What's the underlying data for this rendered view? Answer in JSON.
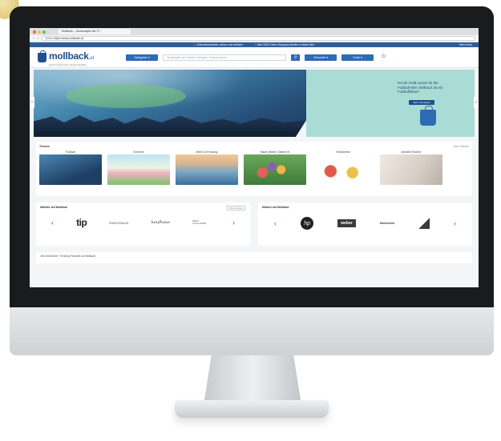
{
  "browser": {
    "tab_title": "Mollback – Gewinnspiel der Fi...",
    "url_secure": "Sicher",
    "url_host": "https://www.mollback.at",
    "nav_back": "‹",
    "nav_forward": "›",
    "dot_colors": [
      "#ec5f59",
      "#f5bf4f",
      "#61c554"
    ]
  },
  "promo": {
    "left": "✓ Gutscheinsvorteile, sichern und einlösen",
    "middle": "✓ Über 5000 Online-Shopping-Händler in dieser Mini",
    "right": "Mein Konto"
  },
  "header": {
    "logo_name": "mollback",
    "logo_tld": ".at",
    "logo_tagline": "Geld zurück beim Online-Einkauf",
    "categories_label": "Kategorien ▾",
    "search_placeholder": "Suchbegriff oder Händler, Kategorie, Produkt suchen",
    "search_icon": "magnifier",
    "select1_label": "Einkaufen ▾",
    "select2_label": "Konto ▾",
    "logout_icon": "power"
  },
  "hero": {
    "text": "Hol dir Geld zurück für die Fußball-WM. Mollback ist ein Fußballfieber!",
    "cta": "Jetzt mitmachen",
    "prev": "‹",
    "next": "›"
  },
  "topics": {
    "heading": "Themen",
    "more": "Alle Themen",
    "items": [
      {
        "label": "Fußball"
      },
      {
        "label": "Sommer"
      },
      {
        "label": "Meer & Erholung"
      },
      {
        "label": "Mach deinen Garten fit"
      },
      {
        "label": "Geschenke"
      },
      {
        "label": "Aktuelle Bücher"
      }
    ]
  },
  "brands_left": {
    "heading": "Händler auf Mollback",
    "filter": "Alle anzeigen",
    "prev": "‹",
    "next": "›",
    "items": [
      "tip",
      "RADOHAUS",
      "kaufhaus",
      "ERIKA SCHLOSSER"
    ]
  },
  "brands_right": {
    "heading": "Marken auf Mollback",
    "prev": "‹",
    "next": "›",
    "items": [
      "hp",
      "weber",
      "KitchenAid",
      "adidas"
    ]
  },
  "bottom": {
    "heading": "Jetzt entdecken: Trending-Produkte auf Mollback"
  }
}
